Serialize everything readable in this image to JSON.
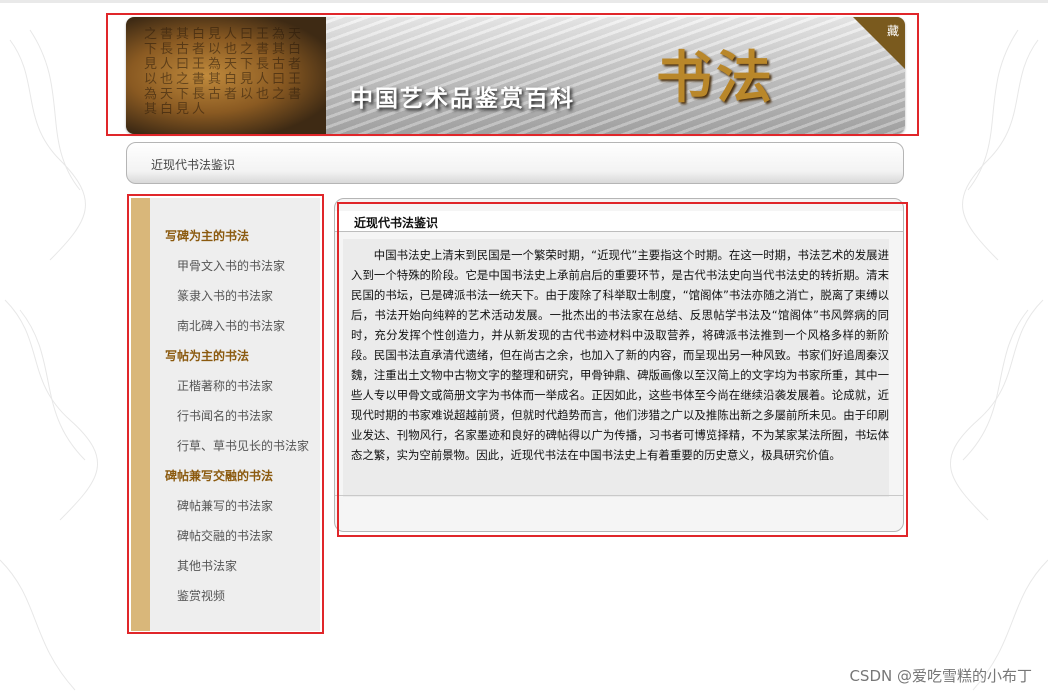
{
  "banner": {
    "title": "中国艺术品鉴赏百科",
    "logo_text": "书法",
    "corner_label": "藏",
    "manuscript_text": "之書其白見人曰王為天下長古者以也之書其白見人曰王為天下長古者以也之書其白見人曰王為天下長古者以也之書其白見人"
  },
  "breadcrumb": {
    "text": "近现代书法鉴识"
  },
  "sidebar": {
    "items": [
      {
        "label": "写碑为主的书法",
        "type": "cat"
      },
      {
        "label": "甲骨文入书的书法家",
        "type": "sub"
      },
      {
        "label": "篆隶入书的书法家",
        "type": "sub"
      },
      {
        "label": "南北碑入书的书法家",
        "type": "sub"
      },
      {
        "label": "写帖为主的书法",
        "type": "cat"
      },
      {
        "label": "正楷著称的书法家",
        "type": "sub"
      },
      {
        "label": "行书闻名的书法家",
        "type": "sub"
      },
      {
        "label": "行草、草书见长的书法家",
        "type": "sub"
      },
      {
        "label": "碑帖兼写交融的书法",
        "type": "cat"
      },
      {
        "label": "碑帖兼写的书法家",
        "type": "sub"
      },
      {
        "label": "碑帖交融的书法家",
        "type": "sub"
      },
      {
        "label": "其他书法家",
        "type": "sub"
      },
      {
        "label": "鉴赏视频",
        "type": "sub"
      }
    ]
  },
  "article": {
    "heading": "近现代书法鉴识",
    "body": "中国书法史上清末到民国是一个繁荣时期，“近现代”主要指这个时期。在这一时期，书法艺术的发展进入到一个特殊的阶段。它是中国书法史上承前启后的重要环节，是古代书法史向当代书法史的转折期。清末民国的书坛，已是碑派书法一统天下。由于废除了科举取士制度，“馆阁体”书法亦随之消亡，脱离了束缚以后，书法开始向纯粹的艺术活动发展。一批杰出的书法家在总结、反思帖学书法及“馆阁体”书风弊病的同时，充分发挥个性创造力，并从新发现的古代书迹材料中汲取营养，将碑派书法推到一个风格多样的新阶段。民国书法直承清代遗绪，但在尚古之余，也加入了新的内容，而呈现出另一种风致。书家们好追周秦汉魏，注重出土文物中古物文字的整理和研究，甲骨钟鼎、碑版画像以至汉简上的文字均为书家所重，其中一些人专以甲骨文或简册文字为书体而一举成名。正因如此，这些书体至今尚在继续沿袭发展着。论成就，近现代时期的书家难说超越前贤，但就时代趋势而言，他们涉猎之广以及推陈出新之多屡前所未见。由于印刷业发达、刊物风行，名家墨迹和良好的碑帖得以广为传播，习书者可博览择精，不为某家某法所囿，书坛体态之繁，实为空前景物。因此，近现代书法在中国书法史上有着重要的历史意义，极具研究价值。"
  },
  "watermark": "CSDN @爱吃雪糕的小布丁",
  "colors": {
    "highlight_box": "#e0262a",
    "sidebar_stripe": "#d9b77a",
    "category_text": "#8b5a0f"
  }
}
